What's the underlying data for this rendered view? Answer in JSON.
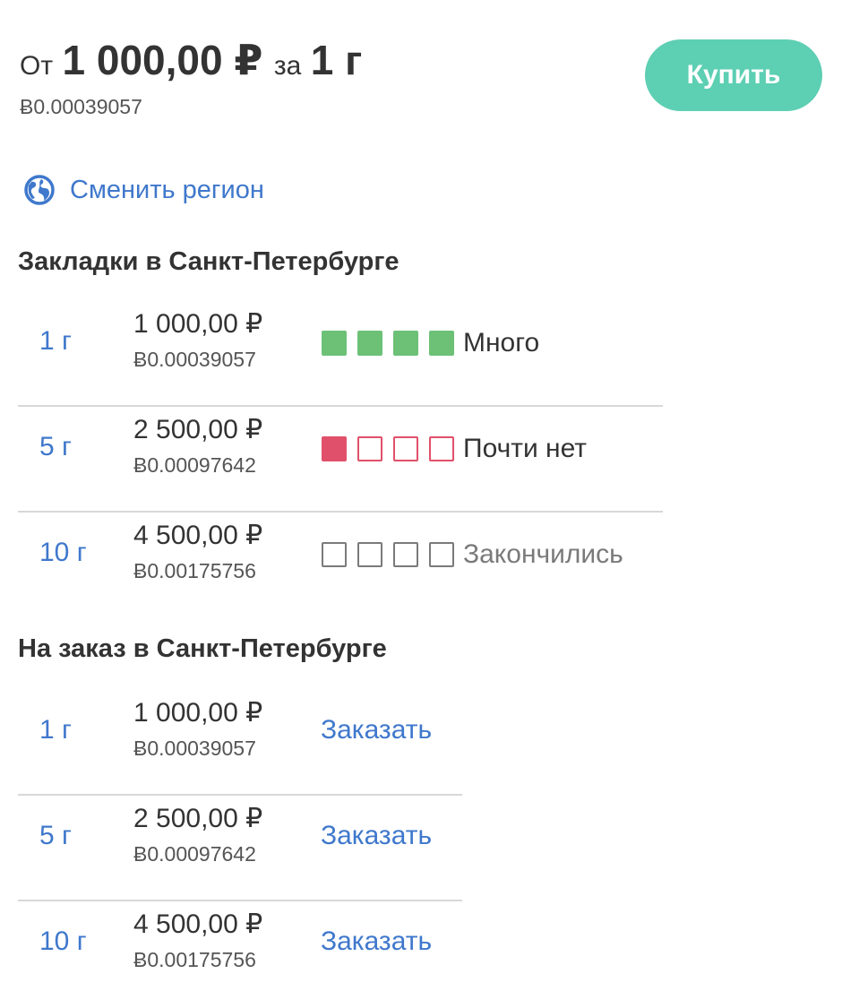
{
  "header": {
    "from_label": "От",
    "price": "1 000,00 ₽",
    "per_label": "за",
    "quantity": "1 г",
    "btc_price": "Ƀ0.00039057",
    "buy_button": "Купить"
  },
  "region": {
    "icon": "globe-icon",
    "label": "Сменить регион"
  },
  "bookmarks": {
    "title": "Закладки в Санкт-Петербурге",
    "items": [
      {
        "quantity": "1 г",
        "price_rub": "1 000,00 ₽",
        "price_btc": "Ƀ0.00039057",
        "stock_level": 4,
        "stock_label": "Много",
        "stock_color": "#6cc177"
      },
      {
        "quantity": "5 г",
        "price_rub": "2 500,00 ₽",
        "price_btc": "Ƀ0.00097642",
        "stock_level": 1,
        "stock_label": "Почти нет",
        "stock_color": "#e0506a"
      },
      {
        "quantity": "10 г",
        "price_rub": "4 500,00 ₽",
        "price_btc": "Ƀ0.00175756",
        "stock_level": 0,
        "stock_label": "Закончились",
        "stock_color": "#7a7a7a"
      }
    ]
  },
  "orders": {
    "title": "На заказ в Санкт-Петербурге",
    "items": [
      {
        "quantity": "1 г",
        "price_rub": "1 000,00 ₽",
        "price_btc": "Ƀ0.00039057",
        "action": "Заказать"
      },
      {
        "quantity": "5 г",
        "price_rub": "2 500,00 ₽",
        "price_btc": "Ƀ0.00097642",
        "action": "Заказать"
      },
      {
        "quantity": "10 г",
        "price_rub": "4 500,00 ₽",
        "price_btc": "Ƀ0.00175756",
        "action": "Заказать"
      }
    ]
  },
  "colors": {
    "accent": "#3f78cc",
    "buy_button": "#5dcfb3",
    "text": "#333333"
  }
}
